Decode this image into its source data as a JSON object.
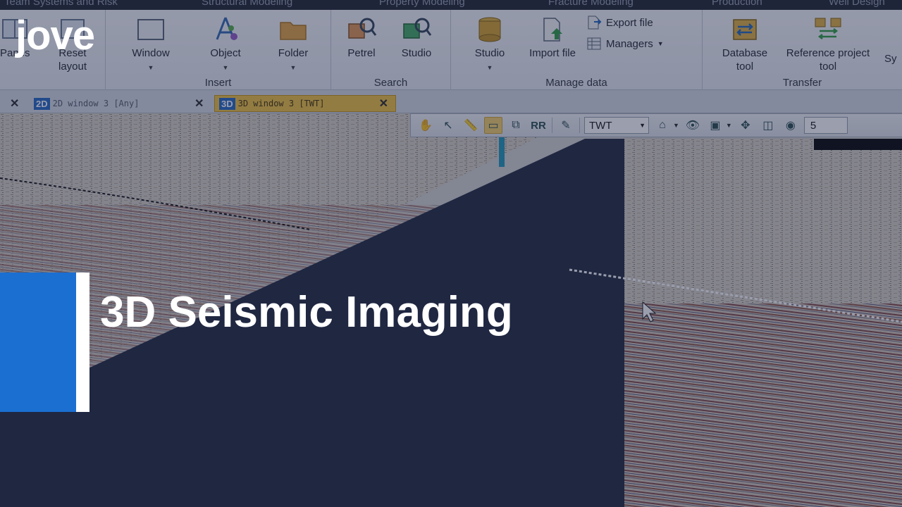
{
  "ribbon": {
    "tabs": [
      "Team Systems and Risk",
      "Structural Modeling",
      "Property Modeling",
      "Fracture Modeling",
      "Production",
      "Well Design"
    ],
    "groups": {
      "insert": {
        "label": "Insert",
        "window_label": "Window",
        "object_label": "Object",
        "folder_label": "Folder"
      },
      "layout": {
        "panes_label": "Panes",
        "reset_label": "Reset layout"
      },
      "search": {
        "label": "Search",
        "petrel_label": "Petrel",
        "studio_label": "Studio"
      },
      "manage": {
        "label": "Manage data",
        "studio_label": "Studio",
        "import_label": "Import file",
        "export_label": "Export file",
        "managers_label": "Managers"
      },
      "transfer": {
        "label": "Transfer",
        "database_label": "Database tool",
        "reference_label": "Reference project tool",
        "sync_label": "Sy"
      }
    }
  },
  "window_tabs": [
    {
      "badge": "2D",
      "label": "2D window 3 [Any]",
      "active": false
    },
    {
      "badge": "3D",
      "label": "3D window 3 [TWT]",
      "active": true
    }
  ],
  "toolbar": {
    "domain_value": "TWT",
    "zoom_value": "5"
  },
  "overlay": {
    "brand": "jove",
    "title": "3D Seismic Imaging"
  },
  "colors": {
    "accent_blue": "#1b6fd1",
    "active_tab": "#f3c447"
  },
  "icons": [
    "pan-hand-icon",
    "select-arrow-icon",
    "measure-ruler-icon",
    "view-mode-icon",
    "pick-icon",
    "rr-icon",
    "edit-icon",
    "home-icon",
    "eye-icon",
    "box-icon",
    "center-icon",
    "cube-icon",
    "camera-icon"
  ]
}
